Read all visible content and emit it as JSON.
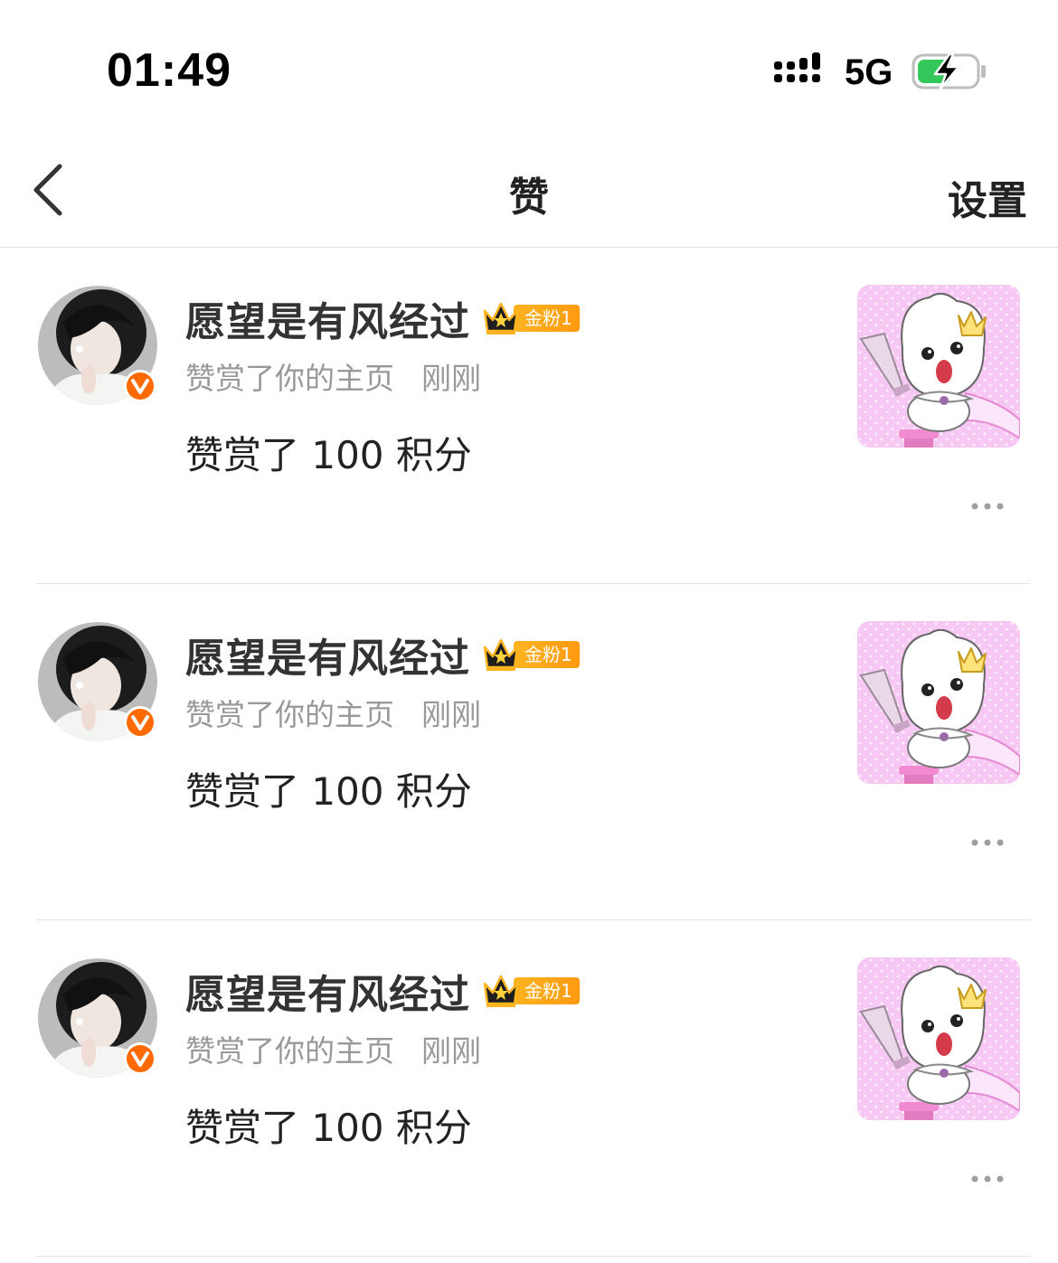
{
  "status_bar": {
    "time": "01:49",
    "network": "5G",
    "icons": [
      "signal-icon",
      "battery-charging-icon"
    ],
    "battery_color": "#34c759"
  },
  "nav": {
    "title": "赞",
    "settings_label": "设置",
    "back_icon": "chevron-left-icon"
  },
  "colors": {
    "meta_text": "#999999",
    "badge_orange": "#ff9a10",
    "verified_orange": "#ff6a00",
    "thumbnail_pink": "#f6c8f3"
  },
  "notifications": [
    {
      "username": "愿望是有风经过",
      "fan_badge": "金粉1",
      "action": "赞赏了你的主页",
      "time": "刚刚",
      "content": "赞赏了 100 积分"
    },
    {
      "username": "愿望是有风经过",
      "fan_badge": "金粉1",
      "action": "赞赏了你的主页",
      "time": "刚刚",
      "content": "赞赏了 100 积分"
    },
    {
      "username": "愿望是有风经过",
      "fan_badge": "金粉1",
      "action": "赞赏了你的主页",
      "time": "刚刚",
      "content": "赞赏了 100 积分"
    }
  ]
}
